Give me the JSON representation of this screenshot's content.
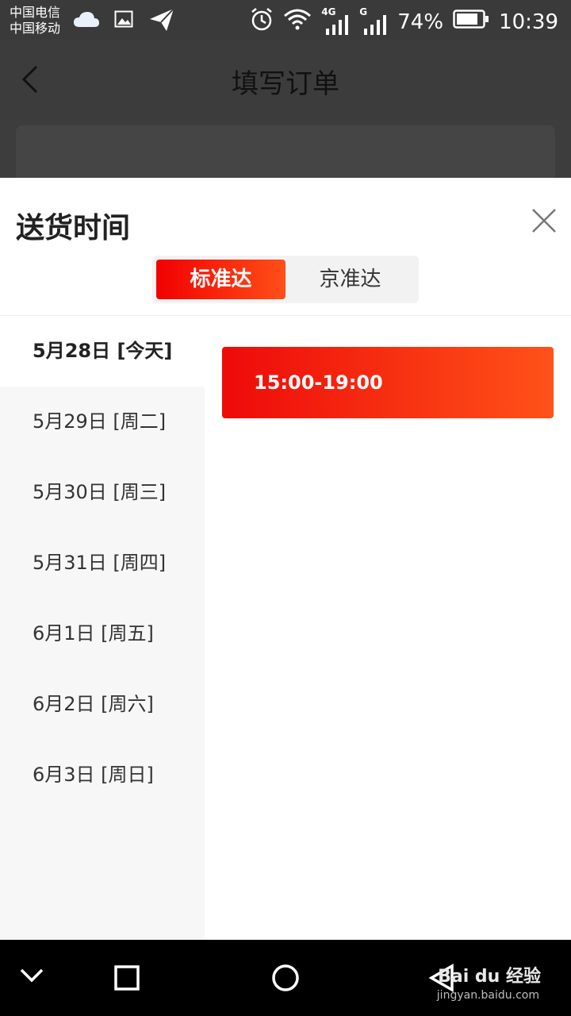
{
  "status_bar": {
    "carrier_1": "中国电信",
    "carrier_2": "中国移动",
    "network_1": "4G",
    "network_2": "G",
    "battery": "74%",
    "time": "10:39"
  },
  "header": {
    "title": "填写订单"
  },
  "sheet": {
    "title": "送货时间",
    "tabs": [
      {
        "label": "标准达",
        "active": true
      },
      {
        "label": "京准达",
        "active": false
      }
    ],
    "dates": [
      {
        "label": "5月28日 [今天]",
        "active": true
      },
      {
        "label": "5月29日 [周二]",
        "active": false
      },
      {
        "label": "5月30日 [周三]",
        "active": false
      },
      {
        "label": "5月31日 [周四]",
        "active": false
      },
      {
        "label": "6月1日 [周五]",
        "active": false
      },
      {
        "label": "6月2日 [周六]",
        "active": false
      },
      {
        "label": "6月3日 [周日]",
        "active": false
      }
    ],
    "slots": [
      {
        "label": "15:00-19:00",
        "selected": true
      }
    ]
  },
  "watermark": {
    "brand": "Bai du 经验",
    "url": "jingyan.baidu.com"
  },
  "colors": {
    "accent_start": "#f10000",
    "accent_end": "#ff4f18",
    "date_list_bg": "#f7f7f7",
    "overlay": "#3c3c3c"
  }
}
